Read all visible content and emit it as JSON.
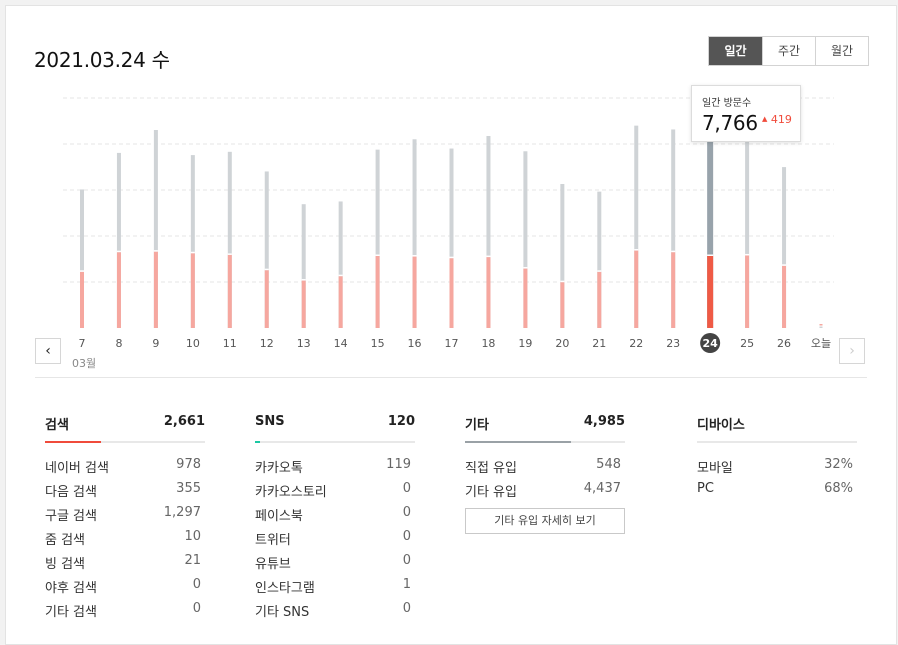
{
  "header": {
    "date": "2021.03.24 수",
    "period_tabs": [
      "일간",
      "주간",
      "월간"
    ],
    "selected_period": "일간"
  },
  "chart_data": {
    "type": "bar",
    "categories": [
      "7",
      "8",
      "9",
      "10",
      "11",
      "12",
      "13",
      "14",
      "15",
      "16",
      "17",
      "18",
      "19",
      "20",
      "21",
      "22",
      "23",
      "24",
      "25",
      "26",
      "오늘"
    ],
    "month_label": "03월",
    "selected_category": "24",
    "series": [
      {
        "name": "",
        "values": [
          2540,
          3210,
          3630,
          3170,
          3230,
          2870,
          2270,
          2320,
          3270,
          3460,
          3290,
          3520,
          3240,
          2640,
          2500,
          3710,
          3640,
          4100,
          3550,
          2950,
          0
        ],
        "color": "#cfd3d6"
      },
      {
        "name": "",
        "values": [
          1030,
          1390,
          1400,
          1370,
          1340,
          1060,
          870,
          950,
          1320,
          1310,
          1280,
          1300,
          1090,
          840,
          1030,
          1420,
          1390,
          1320,
          1330,
          1140,
          0
        ],
        "color": "#f6a79f"
      }
    ],
    "selected_colors": {
      "total": "#98a3ab",
      "part": "#ef5a45"
    },
    "grid": true
  },
  "tooltip": {
    "label": "일간 방문수",
    "value": "7,766",
    "delta": "419",
    "up_arrow": "▲"
  },
  "nav": {
    "prev_icon": "‹",
    "next_icon": "›"
  },
  "stats": {
    "search": {
      "title": "검색",
      "total": "2,661",
      "color": "#f04b3b",
      "fraction": 0.35,
      "rows": [
        {
          "label": "네이버 검색",
          "value": "978"
        },
        {
          "label": "다음 검색",
          "value": "355"
        },
        {
          "label": "구글 검색",
          "value": "1,297"
        },
        {
          "label": "줌 검색",
          "value": "10"
        },
        {
          "label": "빙 검색",
          "value": "21"
        },
        {
          "label": "야후 검색",
          "value": "0"
        },
        {
          "label": "기타 검색",
          "value": "0"
        }
      ]
    },
    "sns": {
      "title": "SNS",
      "total": "120",
      "color": "#1cc7a3",
      "fraction": 0.03,
      "rows": [
        {
          "label": "카카오톡",
          "value": "119"
        },
        {
          "label": "카카오스토리",
          "value": "0"
        },
        {
          "label": "페이스북",
          "value": "0"
        },
        {
          "label": "트위터",
          "value": "0"
        },
        {
          "label": "유튜브",
          "value": "0"
        },
        {
          "label": "인스타그램",
          "value": "1"
        },
        {
          "label": "기타 SNS",
          "value": "0"
        }
      ]
    },
    "etc": {
      "title": "기타",
      "total": "4,985",
      "color": "#9aa1a6",
      "fraction": 0.66,
      "rows": [
        {
          "label": "직접 유입",
          "value": "548"
        },
        {
          "label": "기타 유입",
          "value": "4,437"
        }
      ],
      "detail_button": "기타 유입 자세히 보기"
    },
    "device": {
      "title": "디바이스",
      "rows": [
        {
          "label": "모바일",
          "value": "32%"
        },
        {
          "label": "PC",
          "value": "68%"
        }
      ]
    }
  }
}
